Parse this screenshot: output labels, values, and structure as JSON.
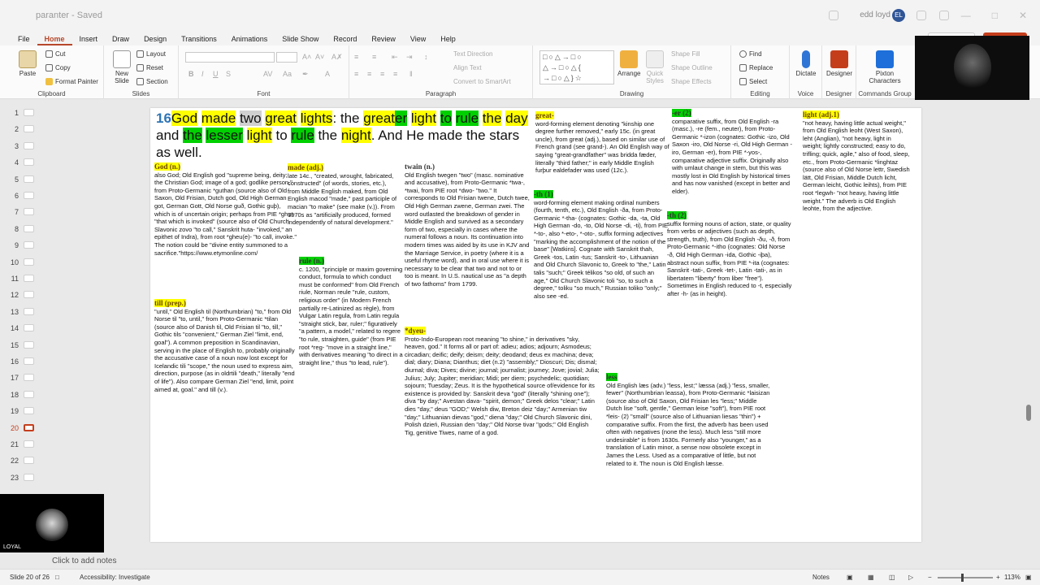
{
  "window": {
    "title": "paranter - Saved",
    "user": "edd loyd",
    "user_initials": "EL"
  },
  "menu": {
    "tabs": [
      "File",
      "Home",
      "Insert",
      "Draw",
      "Design",
      "Transitions",
      "Animations",
      "Slide Show",
      "Record",
      "Review",
      "View",
      "Help"
    ],
    "active": "Home"
  },
  "ribbon": {
    "clipboard": {
      "label": "Clipboard",
      "paste": "Paste",
      "cut": "Cut",
      "copy": "Copy",
      "format_painter": "Format Painter"
    },
    "slides": {
      "label": "Slides",
      "new_slide": "New Slide",
      "layout": "Layout",
      "reset": "Reset",
      "section": "Section"
    },
    "font": {
      "label": "Font"
    },
    "paragraph": {
      "label": "Paragraph",
      "text_direction": "Text Direction",
      "align_text": "Align Text",
      "convert": "Convert to SmartArt"
    },
    "drawing": {
      "label": "Drawing",
      "arrange": "Arrange",
      "quick_styles": "Quick Styles",
      "shape_fill": "Shape Fill",
      "shape_outline": "Shape Outline",
      "shape_effects": "Shape Effects"
    },
    "editing": {
      "label": "Editing",
      "find": "Find",
      "replace": "Replace",
      "select": "Select"
    },
    "voice": {
      "label": "Voice",
      "dictate": "Dictate"
    },
    "designer": {
      "label": "Designer",
      "designer": "Designer"
    },
    "commands": {
      "label": "Commands Group",
      "pixton": "Pixton Characters"
    }
  },
  "thumbnails": {
    "numbers": [
      "1",
      "2",
      "3",
      "4",
      "5",
      "6",
      "7",
      "8",
      "9",
      "10",
      "11",
      "12",
      "13",
      "14",
      "15",
      "16",
      "17",
      "18",
      "19",
      "20",
      "21",
      "22",
      "23"
    ],
    "current": "20"
  },
  "slide": {
    "verse": {
      "number": "16",
      "segments": [
        {
          "t": "God",
          "h": "y"
        },
        {
          "t": " ",
          "h": ""
        },
        {
          "t": "made",
          "h": "y"
        },
        {
          "t": " ",
          "h": ""
        },
        {
          "t": "two",
          "h": "gr"
        },
        {
          "t": " ",
          "h": ""
        },
        {
          "t": "great",
          "h": "y"
        },
        {
          "t": " ",
          "h": ""
        },
        {
          "t": "lights",
          "h": "y"
        },
        {
          "t": ": the ",
          "h": ""
        },
        {
          "t": "great",
          "h": "y"
        },
        {
          "t": "er",
          "h": "g"
        },
        {
          "t": " ",
          "h": ""
        },
        {
          "t": "light",
          "h": "y"
        },
        {
          "t": " ",
          "h": ""
        },
        {
          "t": "to",
          "h": "g"
        },
        {
          "t": " ",
          "h": ""
        },
        {
          "t": "rule",
          "h": "g"
        },
        {
          "t": " ",
          "h": ""
        },
        {
          "t": "the",
          "h": "y"
        },
        {
          "t": " ",
          "h": ""
        },
        {
          "t": "day",
          "h": "y"
        },
        {
          "t": " and ",
          "h": ""
        },
        {
          "t": "the",
          "h": "g"
        },
        {
          "t": " ",
          "h": ""
        },
        {
          "t": "lesser",
          "h": "g"
        },
        {
          "t": " ",
          "h": ""
        },
        {
          "t": "light",
          "h": "y"
        },
        {
          "t": " to ",
          "h": ""
        },
        {
          "t": "rule",
          "h": "g"
        },
        {
          "t": " the ",
          "h": ""
        },
        {
          "t": "night",
          "h": "y"
        },
        {
          "t": ". And He made the stars as well.",
          "h": ""
        }
      ]
    },
    "god_head": "God (n.)",
    "god_text": "also God; Old English god \"supreme being, deity; the Christian God; image of a god; godlike person,\" from Proto-Germanic *guthan (source also of Old Saxon, Old Frisian, Dutch god, Old High German got, German Gott, Old Norse guð, Gothic guþ), which is of uncertain origin; perhaps from PIE *ghut- \"that which is invoked\" (source also of Old Church Slavonic zovo \"to call,\" Sanskrit huta- \"invoked,\" an epithet of Indra), from root *gheu(e)- \"to call, invoke.\" The notion could be \"divine entity summoned to a sacrifice.\"https://www.etymonline.com/",
    "till_head": "till (prep.)",
    "till_text": "\"until,\" Old English til (Northumbrian) \"to,\" from Old Norse til \"to, until,\" from Proto-Germanic *tilan (source also of Danish til, Old Frisian til \"to, till,\" Gothic tils \"convenient,\" German Ziel \"limit, end, goal\"). A common preposition in Scandinavian, serving in the place of English to, probably originally the accusative case of a noun now lost except for Icelandic tili \"scope,\" the noun used to express aim, direction, purpose (as in oldrtili \"death,\" literally \"end of life\"). Also compare German Ziel \"end, limit, point aimed at, goal.\" and till (v.).",
    "made_head": "made (adj.)",
    "made_text": "late 14c., \"created, wrought, fabricated, constructed\" (of words, stories, etc.), from Middle English maked, from Old English macod \"made,\" past participle of macian \"to make\" (see make (v.)). From 1570s as \"artificially produced, formed independently of natural development.\"",
    "rule_head": "rule (n.)",
    "rule_text": "c. 1200, \"principle or maxim governing conduct, formula to which conduct must be conformed\" from Old French riule, Norman reule \"rule, custom, religious order\" (in Modern French partially re-Latinized as règle), from Vulgar Latin regula, from Latin regula \"straight stick, bar, ruler;\" figuratively \"a pattern, a model,\" related to regere \"to rule, straighten, guide\" (from PIE root *reg- \"move in a straight line,\" with derivatives meaning \"to direct in a straight line,\" thus \"to lead, rule\").",
    "twain_head": "twain (n.)",
    "twain_text": "Old English twegen \"two\" (masc. nominative and accusative), from Proto-Germanic *twa-, *twai, from PIE root *dwo- \"two.\" It corresponds to Old Frisian twene, Dutch twee, Old High German zwene, German zwei. The word outlasted the breakdown of gender in Middle English and survived as a secondary form of two, especially in cases where the numeral follows a noun. Its continuation into modern times was aided by its use in KJV and the Marriage Service, in poetry (where it is a useful rhyme word), and in oral use where it is necessary to be clear that two and not to or too is meant. In U.S. nautical use as \"a depth of two fathoms\" from 1799.",
    "dyeu_head": "*dyeu-",
    "dyeu_text": "Proto-Indo-European root meaning \"to shine,\" in derivatives \"sky, heaven, god.\" It forms all or part of: adieu; adios; adjourn; Asmodeus; circadian; deific; deify; deism; deity; deodand; deus ex machina; deva; dial; diary; Diana; Dianthus; diet (n.2) \"assembly;\" Dioscuri; Dis; dismal; diurnal; diva; Dives; divine; journal; journalist; journey; Jove; jovial; Julia; Julius; July; Jupiter; meridian; Midi; per diem; psychedelic; quotidian; sojourn; Tuesday; Zeus. It is the hypothetical source of/evidence for its existence is provided by: Sanskrit deva \"god\" (literally \"shining one\"); diva \"by day;\" Avestan dava- \"spirit, demon;\" Greek delos \"clear;\" Latin dies \"day,\" deus \"GOD;\" Welsh diw, Breton deiz \"day;\" Armenian tiw \"day;\" Lithuanian dievas \"god,\" diena \"day;\" Old Church Slavonic dini, Polish dzień, Russian den \"day;\" Old Norse tivar \"gods;\" Old English Tig, genitive Tiwes, name of a god.",
    "great_head": "great-",
    "great_text": "word-forming element denoting \"kinship one degree further removed,\" early 15c. (in great uncle), from great (adj.), based on similar use of French grand (see grand-). An Old English way of saying \"great-grandfather\" was bridda fæder, literally \"third father;\" in early Middle English furþur ealdefader was used (12c.).",
    "th1_head": "-th (1)",
    "th1_text": "word-forming element making ordinal numbers (fourth, tenth, etc.), Old English -ða, from Proto-Germanic *-tha- (cognates: Gothic -da, -ta, Old High German -do, -to, Old Norse -di, -ti), from PIE *-to-, also *-eto-, *-oto-, suffix forming adjectives \"marking the accomplishment of the notion of the base\" [Watkins]. Cognate with Sanskrit thah, Greek -tos, Latin -tus; Sanskrit -to-, Lithuanian and Old Church Slavonic to, Greek to \"the,\" Latin talis \"such;\" Greek télikos \"so old, of such an age,\" Old Church Slavonic toli \"so, to such a degree,\" toliku \"so much,\" Russian toliko \"only;\" also see -ed.",
    "er_head": "-er (2)",
    "er_text": "comparative suffix, from Old English -ra (masc.), -re (fem., neuter), from Proto-Germanic *-izon (cognates: Gothic -izo, Old Saxon -iro, Old Norse -ri, Old High German -iro, German -er), from PIE *-yos-, comparative adjective suffix. Originally also with umlaut change in stem, but this was mostly lost in Old English by historical times and has now vanished (except in better and elder).",
    "th2_head": "-th (2)",
    "th2_text": "suffix forming nouns of action, state, or quality from verbs or adjectives (such as depth, strength, truth), from Old English -ðu, -ð, from Proto-Germanic *-itho (cognates: Old Norse -ð, Old High German -ida, Gothic -iþa), abstract noun suffix, from PIE *-ita (cognates: Sanskrit -tati-, Greek -tet-, Latin -tati-, as in libertatem \"liberty\" from liber \"free\"). Sometimes in English reduced to -t, especially after -h- (as in height).",
    "less_head": "less",
    "less_text": "Old English læs (adv.) \"less, lest;\" læssa (adj.) \"less, smaller, fewer\" (Northumbrian leassa), from Proto-Germanic *laisizan (source also of Old Saxon, Old Frisian les \"less;\" Middle Dutch lise \"soft, gentle,\" German leise \"soft\"), from PIE root *leis- (2) \"small\" (source also of Lithuanian liesas \"thin\") + comparative suffix. From the first, the adverb has been used often with negatives (none the less). Much less \"still more undesirable\" is from 1630s. Formerly also \"younger,\" as a translation of Latin minor, a sense now obsolete except in James the Less. Used as a comparative of little, but not related to it. The noun is Old English læsse.",
    "light_head": "light (adj.1)",
    "light_text": "\"not heavy, having little actual weight,\" from Old English leoht (West Saxon), leht (Anglian), \"not heavy, light in weight; lightly constructed; easy to do, trifling; quick, agile,\" also of food, sleep, etc., from Proto-Germanic *linghtaz (source also of Old Norse lettr, Swedish lätt, Old Frisian, Middle Dutch licht, German leicht, Gothic leihts), from PIE root *legwh- \"not heavy, having little weight.\" The adverb is Old English leohte, from the adjective."
  },
  "overlays": {
    "presenter_label": "LOYAL"
  },
  "notes": {
    "placeholder": "Click to add notes"
  },
  "status": {
    "slide_info": "Slide 20 of 26",
    "accessibility": "Accessibility: Investigate",
    "notes_btn": "Notes",
    "zoom": "113%"
  },
  "colors": {
    "accent": "#b7472a",
    "highlight_yellow": "#ffff00",
    "highlight_green": "#00d000",
    "link_blue": "#1f5fbf"
  }
}
